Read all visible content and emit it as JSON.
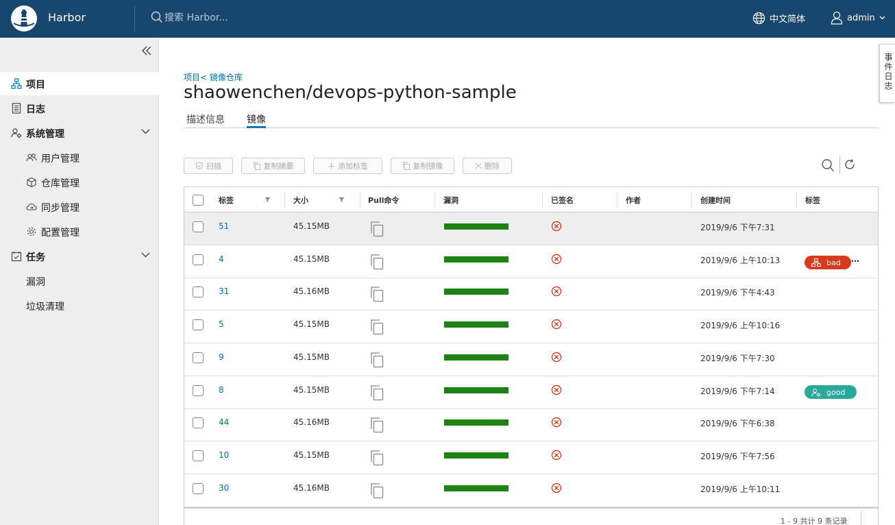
{
  "header": {
    "brand": "Harbor",
    "search_placeholder": "搜索 Harbor...",
    "language": "中文简体",
    "user": "admin"
  },
  "sidebar": {
    "items": [
      {
        "label": "项目",
        "icon": "project-icon"
      },
      {
        "label": "日志",
        "icon": "log-icon"
      },
      {
        "label": "系统管理",
        "icon": "admin-icon"
      },
      {
        "label": "任务",
        "icon": "task-icon"
      }
    ],
    "admin_sub": [
      {
        "label": "用户管理",
        "icon": "users-icon"
      },
      {
        "label": "仓库管理",
        "icon": "registry-icon"
      },
      {
        "label": "同步管理",
        "icon": "replication-icon"
      },
      {
        "label": "配置管理",
        "icon": "config-icon"
      }
    ],
    "task_sub": [
      {
        "label": "漏洞"
      },
      {
        "label": "垃圾清理"
      }
    ]
  },
  "main": {
    "breadcrumb": "项目< 镜像仓库",
    "title": "shaowenchen/devops-python-sample",
    "tabs": [
      "描述信息",
      "镜像"
    ],
    "toolbar": {
      "scan": "扫描",
      "copy_digest": "复制摘要",
      "add_label": "添加标签",
      "copy_image": "复制镜像",
      "delete": "删除"
    }
  },
  "table": {
    "columns": [
      "标签",
      "大小",
      "Pull命令",
      "漏洞",
      "已签名",
      "作者",
      "创建时间",
      "标签"
    ],
    "rows": [
      {
        "tag": "51",
        "size": "45.15MB",
        "created": "2019/9/6 下午7:31",
        "label": ""
      },
      {
        "tag": "4",
        "size": "45.15MB",
        "created": "2019/9/6 上午10:13",
        "label": "bad"
      },
      {
        "tag": "31",
        "size": "45.16MB",
        "created": "2019/9/6 下午4:43",
        "label": ""
      },
      {
        "tag": "5",
        "size": "45.15MB",
        "created": "2019/9/6 上午10:16",
        "label": ""
      },
      {
        "tag": "9",
        "size": "45.15MB",
        "created": "2019/9/6 下午7:30",
        "label": ""
      },
      {
        "tag": "8",
        "size": "45.15MB",
        "created": "2019/9/6 下午7:14",
        "label": "good"
      },
      {
        "tag": "44",
        "size": "45.16MB",
        "created": "2019/9/6 下午6:38",
        "label": ""
      },
      {
        "tag": "10",
        "size": "45.15MB",
        "created": "2019/9/6 下午7:56",
        "label": ""
      },
      {
        "tag": "30",
        "size": "45.16MB",
        "created": "2019/9/6 上午10:11",
        "label": ""
      }
    ],
    "footer": "1 - 9 共计 9 条记录",
    "more": "…"
  },
  "colors": {
    "header": "#17466e",
    "link": "#0072a3",
    "vuln_ok": "#1c8314",
    "unsigned": "#e12200",
    "label_bad": "#d93a1f",
    "label_good": "#2aa99b"
  },
  "event_tab": "事件日志"
}
